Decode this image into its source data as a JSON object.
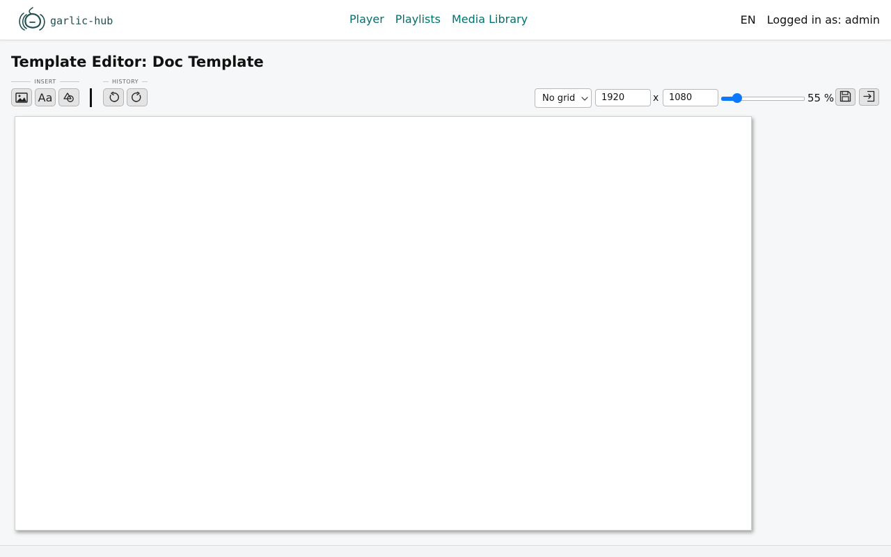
{
  "header": {
    "brand": "garlic-hub",
    "nav": [
      {
        "label": "Player"
      },
      {
        "label": "Playlists"
      },
      {
        "label": "Media Library"
      }
    ],
    "language": "EN",
    "login_status": "Logged in as: admin"
  },
  "page": {
    "title": "Template Editor: Doc Template"
  },
  "toolbar": {
    "insert_label": "INSERT",
    "insert_buttons": [
      {
        "icon": "image-icon"
      },
      {
        "icon": "text-icon",
        "label": "Aa"
      },
      {
        "icon": "shapes-icon"
      }
    ],
    "history_label": "HISTORY",
    "history_buttons": [
      {
        "icon": "undo-icon"
      },
      {
        "icon": "redo-icon"
      }
    ],
    "grid_select": "No grid",
    "width": "1920",
    "separator": "x",
    "height": "1080",
    "zoom": {
      "value": 55,
      "label": "55 %",
      "min": 10,
      "max": 300
    },
    "save_icon": "save-icon",
    "exit_icon": "exit-icon"
  },
  "colors": {
    "nav_link": "#00706c",
    "accent": "#0a78ff",
    "brand": "#1f4f4f"
  }
}
